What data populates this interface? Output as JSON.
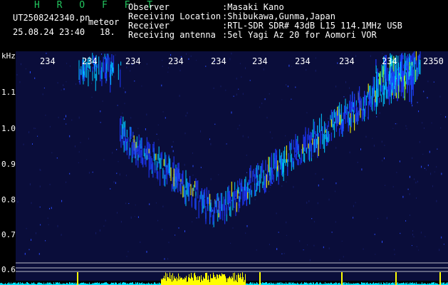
{
  "header": {
    "brand": "H R O F F T",
    "file_name": "UT2508242340.pn",
    "file_tag": "meteor",
    "timestamp": "25.08.24 23:40",
    "count": "18."
  },
  "station": {
    "labels": [
      "Observer",
      "Receiving Location",
      "Receiver",
      "Receiving antenna"
    ],
    "values": [
      ":Masaki Kano",
      ":Shibukawa,Gunma,Japan",
      ":RTL-SDR SDR# 43dB L15 114.1MHz USB",
      ":5el Yagi Az 20 for Aomori VOR"
    ]
  },
  "axis": {
    "unit": "kHz",
    "y_ticks": [
      "1.1",
      "1.0",
      "0.9",
      "0.8",
      "0.7",
      "0.6"
    ],
    "time_ticks": [
      "234",
      "234",
      "234",
      "234",
      "234",
      "234",
      "234",
      "234",
      "234",
      "2350"
    ]
  },
  "colors": {
    "background": "#000000",
    "waterfall_bg": "#0a0d3a",
    "signal_dark": "#1e3aff",
    "signal_mid": "#00c8ff",
    "signal_hot": "#ffff00",
    "brand_green": "#22c55e",
    "guide_line": "#e5e7eb"
  }
}
